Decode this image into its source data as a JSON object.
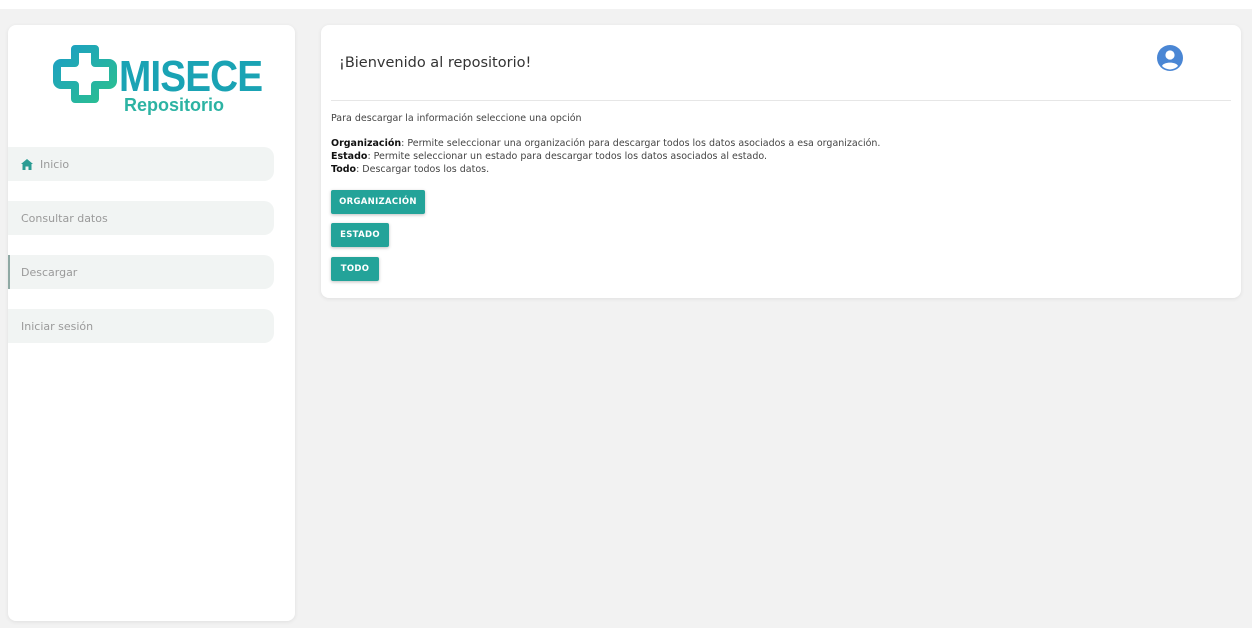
{
  "brand": {
    "name": "MISECE",
    "subtitle": "Repositorio",
    "colors": {
      "primary": "#1aa3b4",
      "secondary": "#2cb3a3"
    }
  },
  "sidebar": {
    "items": [
      {
        "label": "Inicio",
        "icon": "home-icon"
      },
      {
        "label": "Consultar datos"
      },
      {
        "label": "Descargar",
        "active": true
      },
      {
        "label": "Iniciar sesión"
      }
    ]
  },
  "header": {
    "title": "¡Bienvenido al repositorio!",
    "user_icon": "user-circle-icon"
  },
  "content": {
    "intro": "Para descargar la información seleccione una opción",
    "options": [
      {
        "term": "Organización",
        "text": ": Permite seleccionar una organización para descargar todos los datos asociados a esa organización."
      },
      {
        "term": "Estado",
        "text": ": Permite seleccionar un estado para descargar todos los datos asociados al estado."
      },
      {
        "term": "Todo",
        "text": ": Descargar todos los datos."
      }
    ]
  },
  "buttons": {
    "organizacion": "ORGANIZACIÓN",
    "estado": "ESTADO",
    "todo": "TODO",
    "color": "#23a399"
  }
}
